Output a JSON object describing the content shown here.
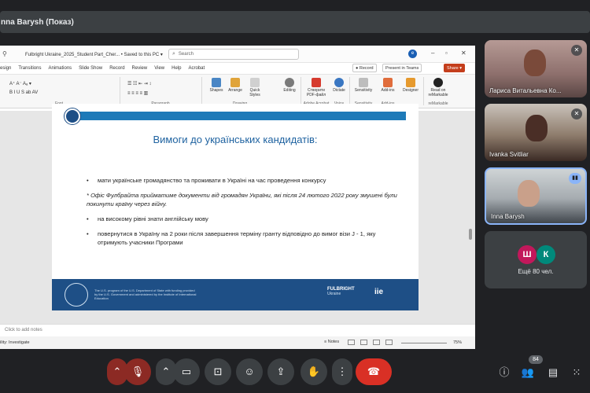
{
  "meeting": {
    "presenter_label": "nna Barysh (Показ)"
  },
  "ppt": {
    "app_icon": "powerpoint-icon",
    "filename": "Fulbright Ukraine_2025_Student Part_Cher... • Saved to this PC ▾",
    "search_placeholder": "Search",
    "user_initial": "e",
    "menu_tabs": [
      "esign",
      "Transitions",
      "Animations",
      "Slide Show",
      "Record",
      "Review",
      "View",
      "Help",
      "Acrobat"
    ],
    "record_btn": "● Record",
    "present_teams_btn": "Present in Teams",
    "share_btn": "Share ▾",
    "ribbon_groups": [
      "Font",
      "Paragraph",
      "Drawing",
      "Adobe Acrobat",
      "Voice",
      "Sensitivity",
      "Add-ins"
    ],
    "ribbon_tools": {
      "shapes": "Shapes",
      "arrange": "Arrange",
      "quick_styles": "Quick Styles",
      "editing": "Editing",
      "create_pdf": "Створити PDF-файл",
      "dictate": "Dictate",
      "sensitivity": "Sensitivity",
      "addins": "Add-ins",
      "designer": "Designer",
      "remarkable": "Read on reMarkable",
      "remarkable_group": "reMarkable"
    },
    "notes_placeholder": "Click to add notes",
    "status_accessibility": "ility: Investigate",
    "status_notes": "Notes",
    "zoom": "75%"
  },
  "slide": {
    "title": "Вимоги до українських кандидатів:",
    "bullets": [
      "мати українське громадянство та проживати в Україні на час проведення конкурсу"
    ],
    "note": "* Офіс Фулбрайта прийматиме документи від громадян України, які після 24 лютого 2022 року змушені були покинути країну через війну.",
    "bullets2": [
      "на високому рівні знати англійську мову",
      "повернутися в Україну на 2 роки після завершення терміну гранту відповідно до вимог візи J - 1, яку отримують учасники Програми"
    ],
    "footer_text": "The U.S. program of the U.S. Department of State with funding provided by the U.S. Government and administered by the Institute of International Education",
    "fulbright_logo": "FULBRIGHT",
    "fulbright_sub": "Ukraine",
    "iie_logo": "iie"
  },
  "participants": [
    {
      "name": "Лариса Витальевна Ко...",
      "mic": "mic-off-icon"
    },
    {
      "name": "Ivanka Svitliar",
      "mic": "mic-off-icon"
    },
    {
      "name": "Inna Barysh",
      "mic": "speaking-icon"
    }
  ],
  "others": {
    "avatar1": "Ш",
    "avatar2": "К",
    "label": "Ещё 80 чел.",
    "avatar1_color": "#c2185b",
    "avatar2_color": "#00897b"
  },
  "controls": {
    "participant_count": "84",
    "icons": [
      "chevron-up-icon",
      "mic-off-icon",
      "chevron-up-icon",
      "camera-icon",
      "captions-icon",
      "emoji-icon",
      "present-icon",
      "raise-hand-icon",
      "more-options-icon",
      "hang-up-icon",
      "info-icon",
      "people-icon",
      "chat-icon",
      "activities-icon"
    ]
  },
  "colors": {
    "accent_red": "#c43e1c",
    "slide_blue": "#1e62a0",
    "hangup": "#d93025",
    "meet_bg": "#202124"
  }
}
